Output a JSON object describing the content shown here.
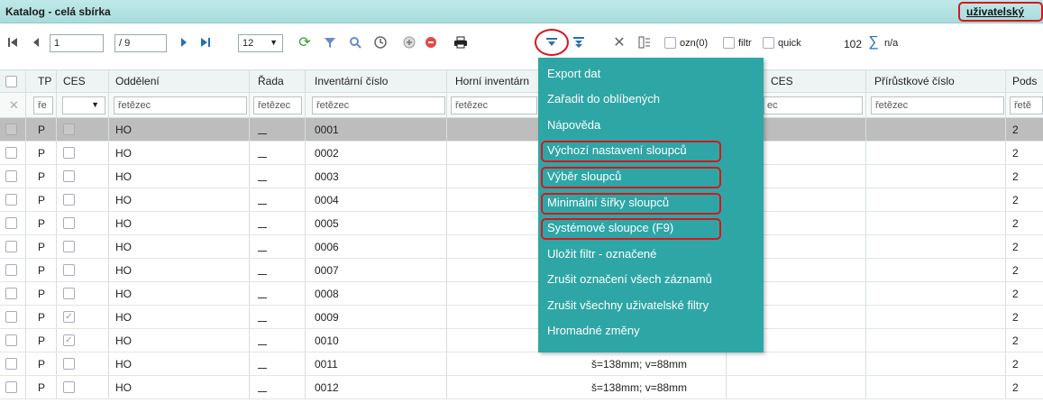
{
  "titlebar": {
    "title": "Katalog - celá sbírka",
    "user_label": "uživatelský"
  },
  "toolbar": {
    "first_icon": "first-page-icon",
    "prev_icon": "prev-page-icon",
    "page_value": "1",
    "page_sep": "/",
    "page_total": "9",
    "next_icon": "next-page-icon",
    "last_icon": "last-page-icon",
    "page_size": "12",
    "refresh_icon": "refresh-icon",
    "filter_icon": "funnel-icon",
    "search_icon": "search-icon",
    "clock_icon": "clock-icon",
    "add_icon": "add-icon",
    "remove_icon": "remove-icon",
    "print_icon": "print-icon",
    "menu_icon": "dropdown-menu-icon",
    "sort_icon": "sort-icon",
    "tools_icon": "tools-icon",
    "columns_icon": "columns-icon",
    "ozn_label": "ozn(0)",
    "filtr_label": "filtr",
    "quick_label": "quick",
    "count": "102",
    "sum_icon": "sum-icon",
    "sum_value": "n/a"
  },
  "table": {
    "headers": {
      "tp": "TP",
      "ces": "CES",
      "oddeleni": "Oddělení",
      "rada": "Řada",
      "inv": "Inventární číslo",
      "horni": "Horní inventárn",
      "ces2": "CES",
      "prir": "Přírůstkové číslo",
      "pods": "Pods"
    },
    "filters": {
      "tp": "ře",
      "oddeleni": "řetězec",
      "rada": "řetězec",
      "inv": "řetězec",
      "horni": "řetězec",
      "ces2": "ec",
      "prir": "řetězec",
      "pods": "řetě"
    },
    "rows": [
      {
        "tp": "P",
        "ces_checked": false,
        "odd": "HO",
        "rada": "_",
        "inv": "0001",
        "rozm": "",
        "pods": "2",
        "selected": true
      },
      {
        "tp": "P",
        "ces_checked": false,
        "odd": "HO",
        "rada": "_",
        "inv": "0002",
        "rozm": "",
        "pods": "2",
        "selected": false
      },
      {
        "tp": "P",
        "ces_checked": false,
        "odd": "HO",
        "rada": "_",
        "inv": "0003",
        "rozm": "",
        "pods": "2",
        "selected": false
      },
      {
        "tp": "P",
        "ces_checked": false,
        "odd": "HO",
        "rada": "_",
        "inv": "0004",
        "rozm": "",
        "pods": "2",
        "selected": false
      },
      {
        "tp": "P",
        "ces_checked": false,
        "odd": "HO",
        "rada": "_",
        "inv": "0005",
        "rozm": "",
        "pods": "2",
        "selected": false
      },
      {
        "tp": "P",
        "ces_checked": false,
        "odd": "HO",
        "rada": "_",
        "inv": "0006",
        "rozm": "",
        "pods": "2",
        "selected": false
      },
      {
        "tp": "P",
        "ces_checked": false,
        "odd": "HO",
        "rada": "_",
        "inv": "0007",
        "rozm": "",
        "pods": "2",
        "selected": false
      },
      {
        "tp": "P",
        "ces_checked": false,
        "odd": "HO",
        "rada": "_",
        "inv": "0008",
        "rozm": "",
        "pods": "2",
        "selected": false
      },
      {
        "tp": "P",
        "ces_checked": true,
        "odd": "HO",
        "rada": "_",
        "inv": "0009",
        "rozm": "",
        "pods": "2",
        "selected": false
      },
      {
        "tp": "P",
        "ces_checked": true,
        "odd": "HO",
        "rada": "_",
        "inv": "0010",
        "rozm": "",
        "pods": "2",
        "selected": false
      },
      {
        "tp": "P",
        "ces_checked": false,
        "odd": "HO",
        "rada": "_",
        "inv": "0011",
        "rozm": "š=138mm; v=88mm",
        "pods": "2",
        "selected": false
      },
      {
        "tp": "P",
        "ces_checked": false,
        "odd": "HO",
        "rada": "_",
        "inv": "0012",
        "rozm": "š=138mm; v=88mm",
        "pods": "2",
        "selected": false
      }
    ]
  },
  "menu": {
    "items": [
      "Export dat",
      "Zařadit do oblíbených",
      "Nápověda",
      "Výchozí nastavení sloupců",
      "Výběr sloupců",
      "Minimální šířky sloupců",
      "Systémové sloupce (F9)",
      "Uložit filtr - označené",
      "Zrušit označení všech záznamů",
      "Zrušit všechny uživatelské filtry",
      "Hromadné změny"
    ]
  },
  "colors": {
    "menu_bg": "#2ea6a6",
    "titlebar_bg": "#a9dcdc",
    "highlight": "#d8161c",
    "selected_row": "#bdbdbd"
  }
}
